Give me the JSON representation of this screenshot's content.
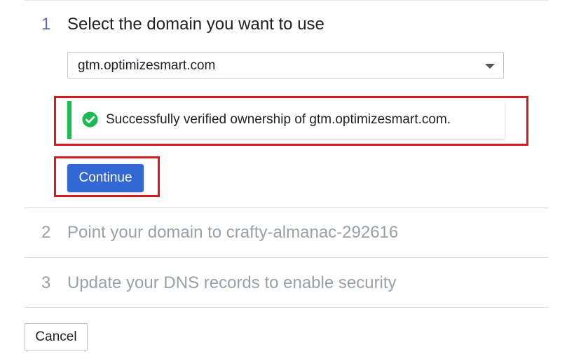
{
  "steps": [
    {
      "number": "1",
      "title": "Select the domain you want to use"
    },
    {
      "number": "2",
      "title": "Point your domain to crafty-almanac-292616"
    },
    {
      "number": "3",
      "title": "Update your DNS records to enable security"
    }
  ],
  "domain_select": {
    "selected": "gtm.optimizesmart.com"
  },
  "notice": {
    "message": "Successfully verified ownership of gtm.optimizesmart.com.",
    "icon": "check-circle-icon"
  },
  "buttons": {
    "continue_label": "Continue",
    "cancel_label": "Cancel"
  },
  "colors": {
    "primary": "#3367d6",
    "success": "#1db954",
    "highlight": "#d71920",
    "active_step_number": "#5c6bc0",
    "inactive_text": "#9aa0a6"
  }
}
